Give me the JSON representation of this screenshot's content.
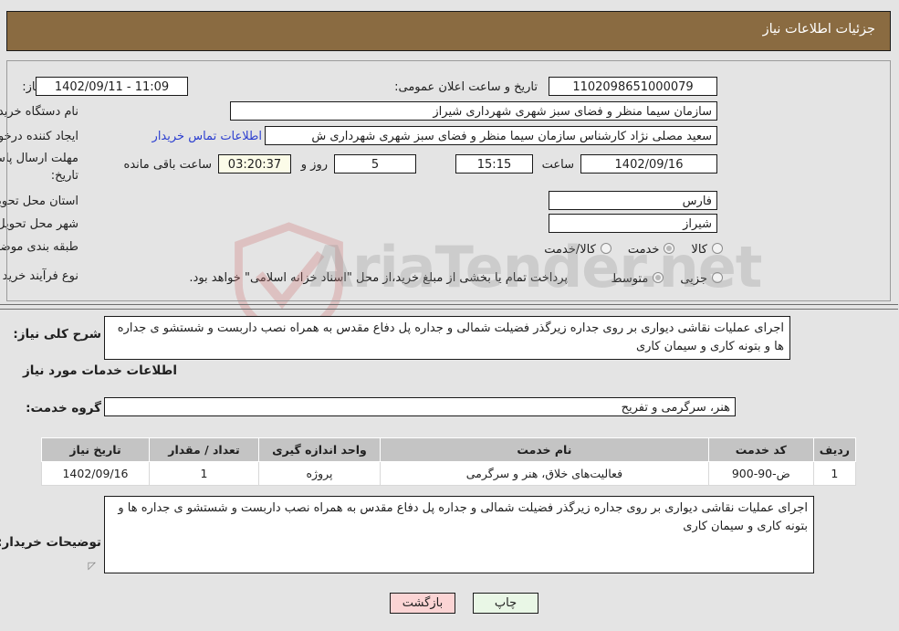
{
  "header": {
    "title": "جزئیات اطلاعات نیاز"
  },
  "watermark": {
    "text": "AriaTender.net"
  },
  "form": {
    "need_number_label": "شماره نیاز:",
    "need_number_value": "1102098651000079",
    "announce_label": "تاریخ و ساعت اعلان عمومی:",
    "announce_value": "11:09 - 1402/09/11",
    "buyer_org_label": "نام دستگاه خریدار:",
    "buyer_org_value": "سازمان سیما منظر و فضای سبز شهری شهرداری شیراز",
    "requester_label": "ایجاد کننده درخواست:",
    "requester_value": "سعید مصلی نژاد کارشناس سازمان سیما منظر و فضای سبز شهری شهرداری ش",
    "contact_link": "اطلاعات تماس خریدار",
    "deadline_label_line1": "مهلت ارسال پاسخ: تا",
    "deadline_label_line2": "تاریخ:",
    "deadline_date": "1402/09/16",
    "deadline_hour_label": "ساعت",
    "deadline_time": "15:15",
    "days_value": "5",
    "days_label": "روز و",
    "countdown_value": "03:20:37",
    "countdown_label": "ساعت باقی مانده",
    "province_label": "استان محل تحویل:",
    "province_value": "فارس",
    "city_label": "شهر محل تحویل:",
    "city_value": "شیراز",
    "category_label": "طبقه بندی موضوعی:",
    "category_options": [
      {
        "label": "کالا",
        "selected": false
      },
      {
        "label": "خدمت",
        "selected": true
      },
      {
        "label": "کالا/خدمت",
        "selected": false
      }
    ],
    "process_label": "نوع فرآیند خرید :",
    "process_options": [
      {
        "label": "جزیی",
        "selected": false
      },
      {
        "label": "متوسط",
        "selected": true
      }
    ],
    "payment_note": "پرداخت تمام یا بخشی از مبلغ خرید،از محل \"اسناد خزانه اسلامی\" خواهد بود."
  },
  "general_description": {
    "label": "شرح کلی نیاز:",
    "value": "اجرای عملیات نقاشی دیواری بر روی جداره زیرگذر فضیلت شمالی و جداره پل دفاع مقدس به همراه نصب داربست و شستشو ی جداره ها و بتونه کاری و سیمان کاری"
  },
  "services_section": {
    "heading": "اطلاعات خدمات مورد نیاز",
    "group_label": "گروه خدمت:",
    "group_value": "هنر، سرگرمی و تفریح"
  },
  "table": {
    "columns": [
      "ردیف",
      "کد خدمت",
      "نام خدمت",
      "واحد اندازه گیری",
      "تعداد / مقدار",
      "تاریخ نیاز"
    ],
    "rows": [
      {
        "row": "1",
        "code": "ض-90-900",
        "name": "فعالیت‌های خلاق، هنر و سرگرمی",
        "unit": "پروژه",
        "qty": "1",
        "date": "1402/09/16"
      }
    ]
  },
  "buyer_notes": {
    "label": "توضیحات خریدار:",
    "value": "اجرای عملیات نقاشی دیواری بر روی جداره زیرگذر فضیلت شمالی و جداره پل دفاع مقدس به همراه نصب داربست و شستشو ی جداره ها و بتونه کاری و سیمان کاری"
  },
  "footer": {
    "print_label": "چاپ",
    "back_label": "بازگشت"
  }
}
